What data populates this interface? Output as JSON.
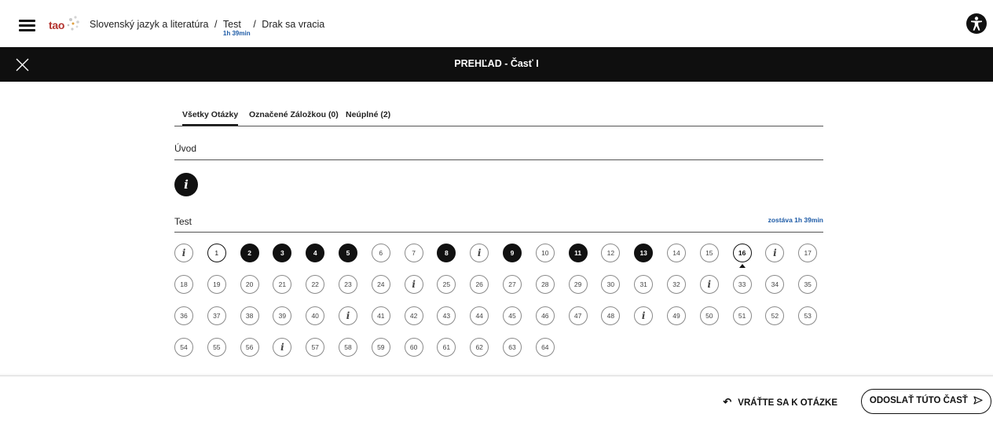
{
  "header": {
    "logo_text": "tao",
    "breadcrumb": [
      "Slovenský jazyk a literatúra",
      "Test",
      "Drak sa vracia"
    ],
    "breadcrumb_separator": "/",
    "timer_short": "1h 39min"
  },
  "titlebar": {
    "title": "PREHĽAD - Časť I"
  },
  "tabs": [
    {
      "label": "Všetky Otázky",
      "active": true
    },
    {
      "label": "Označené Záložkou (0)",
      "active": false
    },
    {
      "label": "Neúplné (2)",
      "active": false
    }
  ],
  "sections": {
    "intro": {
      "title": "Úvod",
      "info_symbol": "i"
    },
    "test": {
      "title": "Test",
      "remaining": "zostáva 1h 39min"
    }
  },
  "questions": [
    {
      "label": "i",
      "state": "info"
    },
    {
      "label": "1",
      "state": "outline"
    },
    {
      "label": "2",
      "state": "done"
    },
    {
      "label": "3",
      "state": "done"
    },
    {
      "label": "4",
      "state": "done"
    },
    {
      "label": "5",
      "state": "done"
    },
    {
      "label": "6",
      "state": "empty"
    },
    {
      "label": "7",
      "state": "empty"
    },
    {
      "label": "8",
      "state": "done"
    },
    {
      "label": "i",
      "state": "info"
    },
    {
      "label": "9",
      "state": "done"
    },
    {
      "label": "10",
      "state": "empty"
    },
    {
      "label": "11",
      "state": "done"
    },
    {
      "label": "12",
      "state": "empty"
    },
    {
      "label": "13",
      "state": "done"
    },
    {
      "label": "14",
      "state": "empty"
    },
    {
      "label": "15",
      "state": "empty"
    },
    {
      "label": "16",
      "state": "current"
    },
    {
      "label": "i",
      "state": "info"
    },
    {
      "label": "17",
      "state": "empty"
    },
    {
      "label": "18",
      "state": "empty"
    },
    {
      "label": "19",
      "state": "empty"
    },
    {
      "label": "20",
      "state": "empty"
    },
    {
      "label": "21",
      "state": "empty"
    },
    {
      "label": "22",
      "state": "empty"
    },
    {
      "label": "23",
      "state": "empty"
    },
    {
      "label": "24",
      "state": "empty"
    },
    {
      "label": "i",
      "state": "info"
    },
    {
      "label": "25",
      "state": "empty"
    },
    {
      "label": "26",
      "state": "empty"
    },
    {
      "label": "27",
      "state": "empty"
    },
    {
      "label": "28",
      "state": "empty"
    },
    {
      "label": "29",
      "state": "empty"
    },
    {
      "label": "30",
      "state": "empty"
    },
    {
      "label": "31",
      "state": "empty"
    },
    {
      "label": "32",
      "state": "empty"
    },
    {
      "label": "i",
      "state": "info"
    },
    {
      "label": "33",
      "state": "empty"
    },
    {
      "label": "34",
      "state": "empty"
    },
    {
      "label": "35",
      "state": "empty"
    },
    {
      "label": "36",
      "state": "empty"
    },
    {
      "label": "37",
      "state": "empty"
    },
    {
      "label": "38",
      "state": "empty"
    },
    {
      "label": "39",
      "state": "empty"
    },
    {
      "label": "40",
      "state": "empty"
    },
    {
      "label": "i",
      "state": "info"
    },
    {
      "label": "41",
      "state": "empty"
    },
    {
      "label": "42",
      "state": "empty"
    },
    {
      "label": "43",
      "state": "empty"
    },
    {
      "label": "44",
      "state": "empty"
    },
    {
      "label": "45",
      "state": "empty"
    },
    {
      "label": "46",
      "state": "empty"
    },
    {
      "label": "47",
      "state": "empty"
    },
    {
      "label": "48",
      "state": "empty"
    },
    {
      "label": "i",
      "state": "info"
    },
    {
      "label": "49",
      "state": "empty"
    },
    {
      "label": "50",
      "state": "empty"
    },
    {
      "label": "51",
      "state": "empty"
    },
    {
      "label": "52",
      "state": "empty"
    },
    {
      "label": "53",
      "state": "empty"
    },
    {
      "label": "54",
      "state": "empty"
    },
    {
      "label": "55",
      "state": "empty"
    },
    {
      "label": "56",
      "state": "empty"
    },
    {
      "label": "i",
      "state": "info"
    },
    {
      "label": "57",
      "state": "empty"
    },
    {
      "label": "58",
      "state": "empty"
    },
    {
      "label": "59",
      "state": "empty"
    },
    {
      "label": "60",
      "state": "empty"
    },
    {
      "label": "61",
      "state": "empty"
    },
    {
      "label": "62",
      "state": "empty"
    },
    {
      "label": "63",
      "state": "empty"
    },
    {
      "label": "64",
      "state": "empty"
    }
  ],
  "footer": {
    "back_label": "VRÁŤTE SA K OTÁZKE",
    "submit_label": "ODOSLAŤ TÚTO ČASŤ"
  },
  "colors": {
    "titlebar_bg": "#0f0f0f",
    "accent_blue": "#1c5aa6",
    "logo_red": "#b4332f"
  },
  "icons": {
    "menu": "hamburger-icon",
    "accessibility": "accessibility-icon",
    "close": "close-icon",
    "back": "back-arrow-icon",
    "send": "send-icon"
  }
}
